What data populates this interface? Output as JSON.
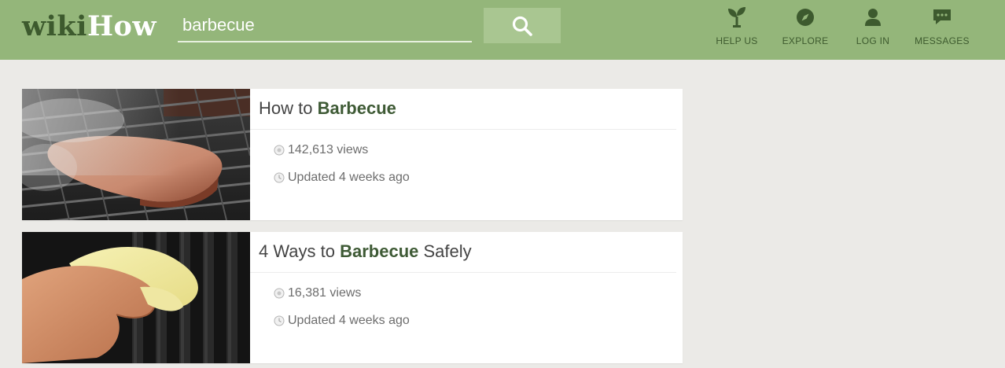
{
  "header": {
    "logo_part1": "wiki",
    "logo_part2": "How",
    "search_value": "barbecue",
    "nav": [
      {
        "label": "HELP US",
        "icon": "sprout-icon"
      },
      {
        "label": "EXPLORE",
        "icon": "compass-icon"
      },
      {
        "label": "LOG IN",
        "icon": "user-icon"
      },
      {
        "label": "MESSAGES",
        "icon": "chat-bubble-icon"
      }
    ]
  },
  "results": [
    {
      "title_pre": "How to ",
      "title_bold": "Barbecue",
      "title_post": "",
      "views": "142,613 views",
      "updated": "Updated 4 weeks ago"
    },
    {
      "title_pre": "4 Ways to ",
      "title_bold": "Barbecue",
      "title_post": " Safely",
      "views": "16,381 views",
      "updated": "Updated 4 weeks ago"
    }
  ],
  "colors": {
    "header_bg": "#94b67a",
    "accent_dark": "#3d5a2e",
    "page_bg": "#ebeae7"
  }
}
